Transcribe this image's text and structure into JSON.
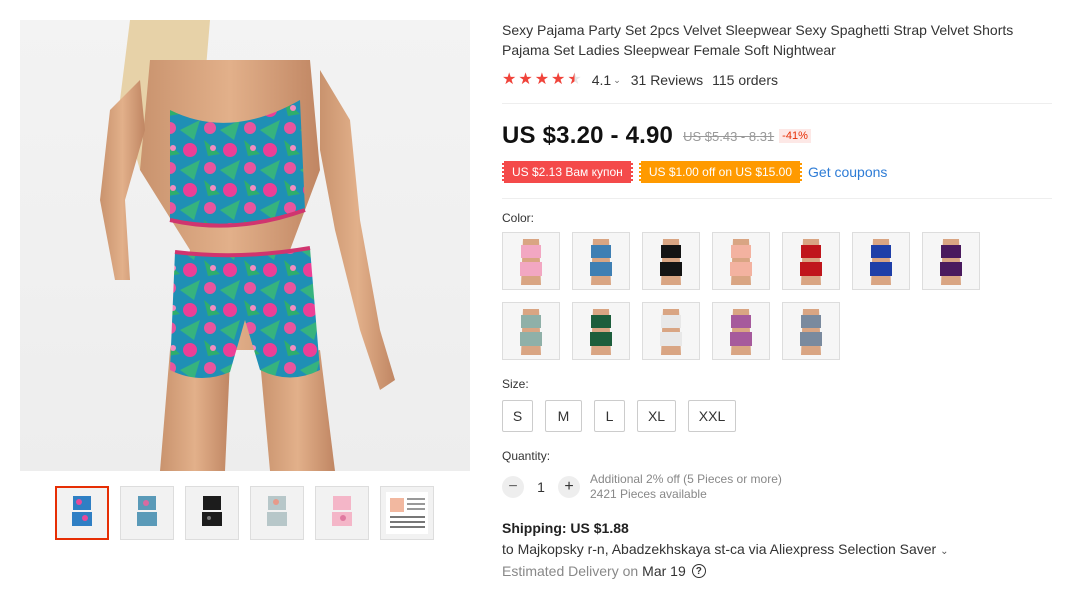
{
  "product": {
    "title": "Sexy Pajama Party Set 2pcs Velvet Sleepwear Sexy Spaghetti Strap Velvet Shorts Pajama Set Ladies Sleepwear Female Soft Nightwear",
    "rating_value": "4.1",
    "rating_stars": 4.1,
    "reviews": "31 Reviews",
    "orders": "115 orders",
    "price": "US $3.20 - 4.90",
    "old_price": "US $5.43 - 8.31",
    "discount": "-41%",
    "coupon_red": "US $2.13 Вам купон",
    "coupon_orange": "US $1.00 off on US $15.00",
    "get_coupons": "Get coupons"
  },
  "gallery": {
    "thumbnails": [
      {
        "color": "#2f7fc4",
        "accent": "#e84a9a"
      },
      {
        "color": "#5a9ab8",
        "accent": "#d86aa0"
      },
      {
        "color": "#1c1c1c",
        "accent": "#3a3a3a"
      },
      {
        "color": "#b7c7c9",
        "accent": "#e79a8a"
      },
      {
        "color": "#f4b6c8",
        "accent": "#e07aa0"
      },
      {
        "color": "#ffffff",
        "accent": "#999999"
      }
    ]
  },
  "options": {
    "color_label": "Color:",
    "colors": [
      {
        "color": "#f2a7c2"
      },
      {
        "color": "#3f7fb3"
      },
      {
        "color": "#141414"
      },
      {
        "color": "#f3b2a0"
      },
      {
        "color": "#c0161c"
      },
      {
        "color": "#1f3fa8"
      },
      {
        "color": "#4a1a5e"
      },
      {
        "color": "#8fb0a8"
      },
      {
        "color": "#1d5e3c"
      },
      {
        "color": "#e8e8e8"
      },
      {
        "color": "#a65a9c"
      },
      {
        "color": "#7a8a9e"
      }
    ],
    "size_label": "Size:",
    "sizes": [
      "S",
      "M",
      "L",
      "XL",
      "XXL"
    ]
  },
  "quantity": {
    "label": "Quantity:",
    "minus": "−",
    "value": "1",
    "plus": "+",
    "note1": "Additional 2% off (5 Pieces or more)",
    "note2": "2421 Pieces available"
  },
  "shipping": {
    "title": "Shipping: US $1.88",
    "destination": "to Majkopsky r-n, Abadzekhskaya st-ca via Aliexpress Selection Saver",
    "delivery_label": "Estimated Delivery on",
    "delivery_date": "Mar 19"
  }
}
